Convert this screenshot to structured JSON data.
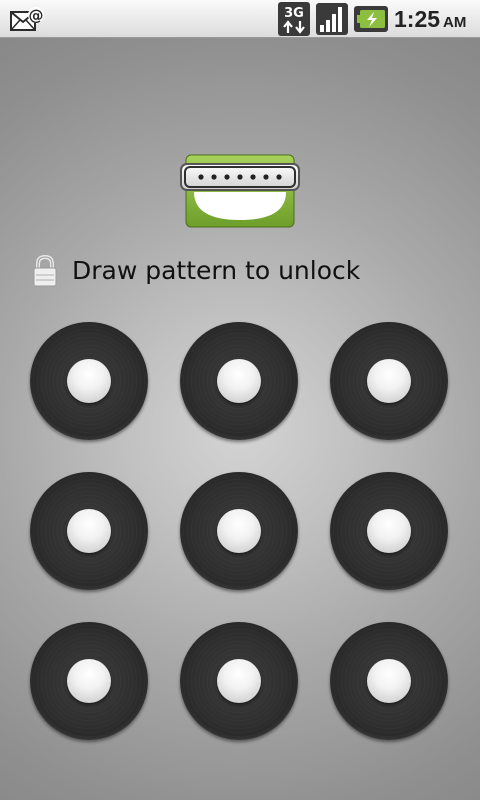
{
  "status_bar": {
    "icons": [
      "email-notification-icon",
      "3g-data-icon",
      "signal-strength-icon",
      "battery-charging-icon"
    ],
    "time": "1:25",
    "ampm": "AM"
  },
  "lock_screen": {
    "icon": "pattern-lock-icon",
    "instruction_icon": "padlock-icon",
    "instruction": "Draw pattern to unlock"
  },
  "pattern": {
    "rows": 3,
    "columns": 3,
    "dots": [
      "dot-1",
      "dot-2",
      "dot-3",
      "dot-4",
      "dot-5",
      "dot-6",
      "dot-7",
      "dot-8",
      "dot-9"
    ]
  },
  "colors": {
    "accent_green": "#8cbf3f",
    "dot_dark": "#2f2f2f",
    "dot_center": "#f2f2f2",
    "background": "#b4b4b4"
  }
}
